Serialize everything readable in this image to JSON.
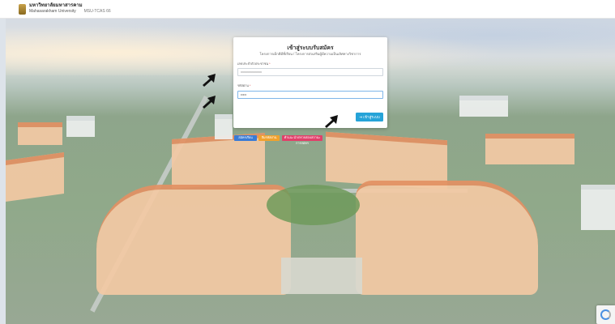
{
  "header": {
    "university_name_th": "มหาวิทยาลัยมหาสารคาม",
    "university_name_en": "Mahasarakham University",
    "system_tag": "MSU-TCAS 66"
  },
  "login": {
    "title": "เข้าสู่ระบบรับสมัคร",
    "subtitle": "โครงการเด็กดีมีที่เรียน / โครงการส่งเสริมผู้มีความเป็นเลิศทางวิชาการ",
    "id_label": "เลขประจำตัวประชาชน",
    "id_value": "xxxxxxxxxxxxx",
    "password_label": "รหัสผ่าน",
    "password_value": "•••••",
    "submit_label": "เข้าสู่ระบบ"
  },
  "actions": {
    "register_label": "สมัครเรียน",
    "forgot_label": "ลืมรหัสผ่าน",
    "guide_label": "คำแนะนำ/ตรวจสอบสถานะการสมัคร",
    "register_color": "#3a7bd5",
    "forgot_color": "#f0a22e",
    "guide_color": "#e0406a"
  },
  "overlay": {
    "arrow_icon": "pointer-arrow-icon"
  },
  "colors": {
    "accent": "#26a3d8",
    "roof": "#e39163"
  }
}
